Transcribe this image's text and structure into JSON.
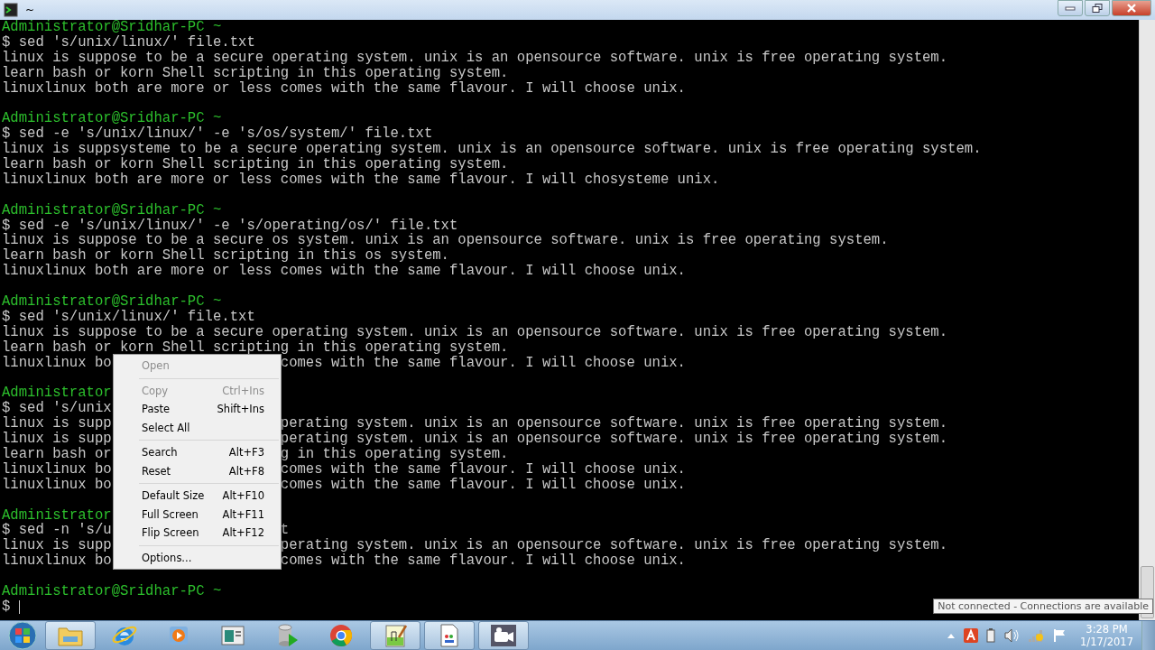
{
  "window": {
    "title": "~"
  },
  "terminal": {
    "lines": [
      {
        "kind": "prompt",
        "text": "Administrator@Sridhar-PC ~"
      },
      {
        "kind": "command",
        "text": "$ sed 's/unix/linux/' file.txt"
      },
      {
        "kind": "output",
        "text": "linux is suppose to be a secure operating system. unix is an opensource software. unix is free operating system."
      },
      {
        "kind": "output",
        "text": "learn bash or korn Shell scripting in this operating system."
      },
      {
        "kind": "output",
        "text": "linuxlinux both are more or less comes with the same flavour. I will choose unix."
      },
      {
        "kind": "blank"
      },
      {
        "kind": "prompt",
        "text": "Administrator@Sridhar-PC ~"
      },
      {
        "kind": "command",
        "text": "$ sed -e 's/unix/linux/' -e 's/os/system/' file.txt"
      },
      {
        "kind": "output",
        "text": "linux is suppsysteme to be a secure operating system. unix is an opensource software. unix is free operating system."
      },
      {
        "kind": "output",
        "text": "learn bash or korn Shell scripting in this operating system."
      },
      {
        "kind": "output",
        "text": "linuxlinux both are more or less comes with the same flavour. I will chosysteme unix."
      },
      {
        "kind": "blank"
      },
      {
        "kind": "prompt",
        "text": "Administrator@Sridhar-PC ~"
      },
      {
        "kind": "command",
        "text": "$ sed -e 's/unix/linux/' -e 's/operating/os/' file.txt"
      },
      {
        "kind": "output",
        "text": "linux is suppose to be a secure os system. unix is an opensource software. unix is free operating system."
      },
      {
        "kind": "output",
        "text": "learn bash or korn Shell scripting in this os system."
      },
      {
        "kind": "output",
        "text": "linuxlinux both are more or less comes with the same flavour. I will choose unix."
      },
      {
        "kind": "blank"
      },
      {
        "kind": "prompt",
        "text": "Administrator@Sridhar-PC ~"
      },
      {
        "kind": "command",
        "text": "$ sed 's/unix/linux/' file.txt"
      },
      {
        "kind": "output",
        "text": "linux is suppose to be a secure operating system. unix is an opensource software. unix is free operating system."
      },
      {
        "kind": "output",
        "text": "learn bash or korn Shell scripting in this operating system."
      },
      {
        "kind": "output",
        "text": "linuxlinux bo",
        "after": "comes with the same flavour. I will choose unix."
      },
      {
        "kind": "blank"
      },
      {
        "kind": "prompt",
        "text": "Administrator"
      },
      {
        "kind": "command",
        "text": "$ sed 's/unix"
      },
      {
        "kind": "output",
        "text": "linux is supp",
        "after": "perating system. unix is an opensource software. unix is free operating system."
      },
      {
        "kind": "output",
        "text": "linux is supp",
        "after": "perating system. unix is an opensource software. unix is free operating system."
      },
      {
        "kind": "output",
        "text": "learn bash or",
        "after": "g in this operating system."
      },
      {
        "kind": "output",
        "text": "linuxlinux bo",
        "after": "comes with the same flavour. I will choose unix."
      },
      {
        "kind": "output",
        "text": "linuxlinux bo",
        "after": "comes with the same flavour. I will choose unix."
      },
      {
        "kind": "blank"
      },
      {
        "kind": "prompt",
        "text": "Administrator"
      },
      {
        "kind": "command",
        "text": "$ sed -n 's/u",
        "after": "t"
      },
      {
        "kind": "output",
        "text": "linux is supp",
        "after": "perating system. unix is an opensource software. unix is free operating system."
      },
      {
        "kind": "output",
        "text": "linuxlinux bo",
        "after": "comes with the same flavour. I will choose unix."
      },
      {
        "kind": "blank"
      },
      {
        "kind": "prompt",
        "text": "Administrator@Sridhar-PC ~"
      },
      {
        "kind": "input",
        "text": "$ "
      }
    ]
  },
  "context_menu": {
    "groups": [
      [
        {
          "label": "Open",
          "disabled": true
        }
      ],
      [
        {
          "label": "Copy",
          "shortcut": "Ctrl+Ins",
          "disabled": true
        },
        {
          "label": "Paste",
          "shortcut": "Shift+Ins",
          "disabled": false
        },
        {
          "label": "Select All",
          "disabled": false
        }
      ],
      [
        {
          "label": "Search",
          "shortcut": "Alt+F3",
          "disabled": false
        },
        {
          "label": "Reset",
          "shortcut": "Alt+F8",
          "disabled": false
        }
      ],
      [
        {
          "label": "Default Size",
          "shortcut": "Alt+F10",
          "disabled": false
        },
        {
          "label": "Full Screen",
          "shortcut": "Alt+F11",
          "disabled": false
        },
        {
          "label": "Flip Screen",
          "shortcut": "Alt+F12",
          "disabled": false
        }
      ],
      [
        {
          "label": "Options...",
          "disabled": false
        }
      ]
    ]
  },
  "tooltip": "Not connected - Connections are available",
  "taskbar": {
    "apps": [
      {
        "kind": "folder",
        "running": true
      },
      {
        "kind": "browser-e",
        "running": false
      },
      {
        "kind": "media",
        "running": false
      },
      {
        "kind": "window",
        "running": false
      },
      {
        "kind": "database",
        "running": false
      },
      {
        "kind": "chrome",
        "running": false
      },
      {
        "kind": "editor",
        "running": true
      },
      {
        "kind": "document",
        "running": true
      },
      {
        "kind": "camera",
        "running": true
      }
    ],
    "clock": {
      "time": "3:28 PM",
      "date": "1/17/2017"
    }
  }
}
